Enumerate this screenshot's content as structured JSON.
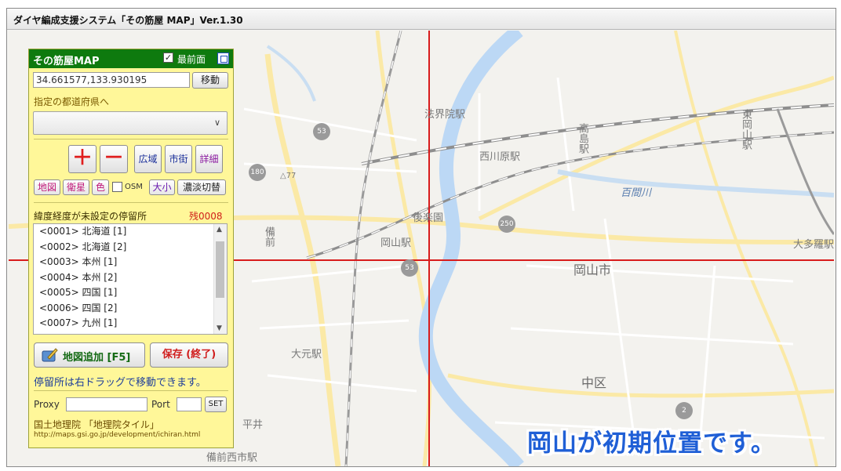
{
  "window": {
    "title": "ダイヤ編成支援システム「その筋屋 MAP」Ver.1.30"
  },
  "panel": {
    "title": "その筋屋MAP",
    "always_on_top_label": "最前面",
    "always_on_top_checked": "✓",
    "coordinates_value": "34.661577,133.930195",
    "move_label": "移動",
    "prefecture_label": "指定の都道府県へ",
    "prefecture_selected": "",
    "zoom_in_label": "＋",
    "zoom_out_label": "－",
    "zoom_buttons": [
      "広域",
      "市街",
      "詳細"
    ],
    "layer_buttons": {
      "map": "地図",
      "satellite": "衛星",
      "color": "色",
      "osm": "OSM",
      "size": "大小",
      "shade_toggle": "濃淡切替"
    },
    "stops_header": "緯度経度が未設定の停留所",
    "remaining_label": "残0008",
    "stops": [
      "<0001> 北海道 [1]",
      "<0002> 北海道 [2]",
      "<0003> 本州 [1]",
      "<0004> 本州 [2]",
      "<0005> 四国 [1]",
      "<0006> 四国 [2]",
      "<0007> 九州 [1]"
    ],
    "add_map_label": "地図追加 [F5]",
    "save_label": "保存 (終了)",
    "drag_hint": "停留所は右ドラッグで移動できます。",
    "proxy_label": "Proxy",
    "proxy_value": "",
    "port_label": "Port",
    "port_value": "",
    "set_label": "SET",
    "credit": "国土地理院 「地理院タイル」",
    "credit_url": "http://maps.gsi.go.jp/development/ichiran.html"
  },
  "map": {
    "labels": {
      "hokaiin_station": "法界院駅",
      "nishigawara_station": "西川原駅",
      "takashima_station": "高島駅",
      "higashi_okayama_station": "東岡山駅",
      "hyakken_river": "百間川",
      "korakuen": "後楽園",
      "okayama_station": "岡山駅",
      "okayama_city": "岡山市",
      "ootama_station": "大多羅駅",
      "omoto_station": "大元駅",
      "naka_ku": "中区",
      "bizen_line": "備前",
      "hirai": "平井",
      "bizen_nishiichi_station": "備前西市駅",
      "elevation": "△77"
    },
    "road_numbers": [
      "53",
      "53",
      "180",
      "250",
      "2"
    ]
  },
  "caption": "岡山が初期位置です。"
}
